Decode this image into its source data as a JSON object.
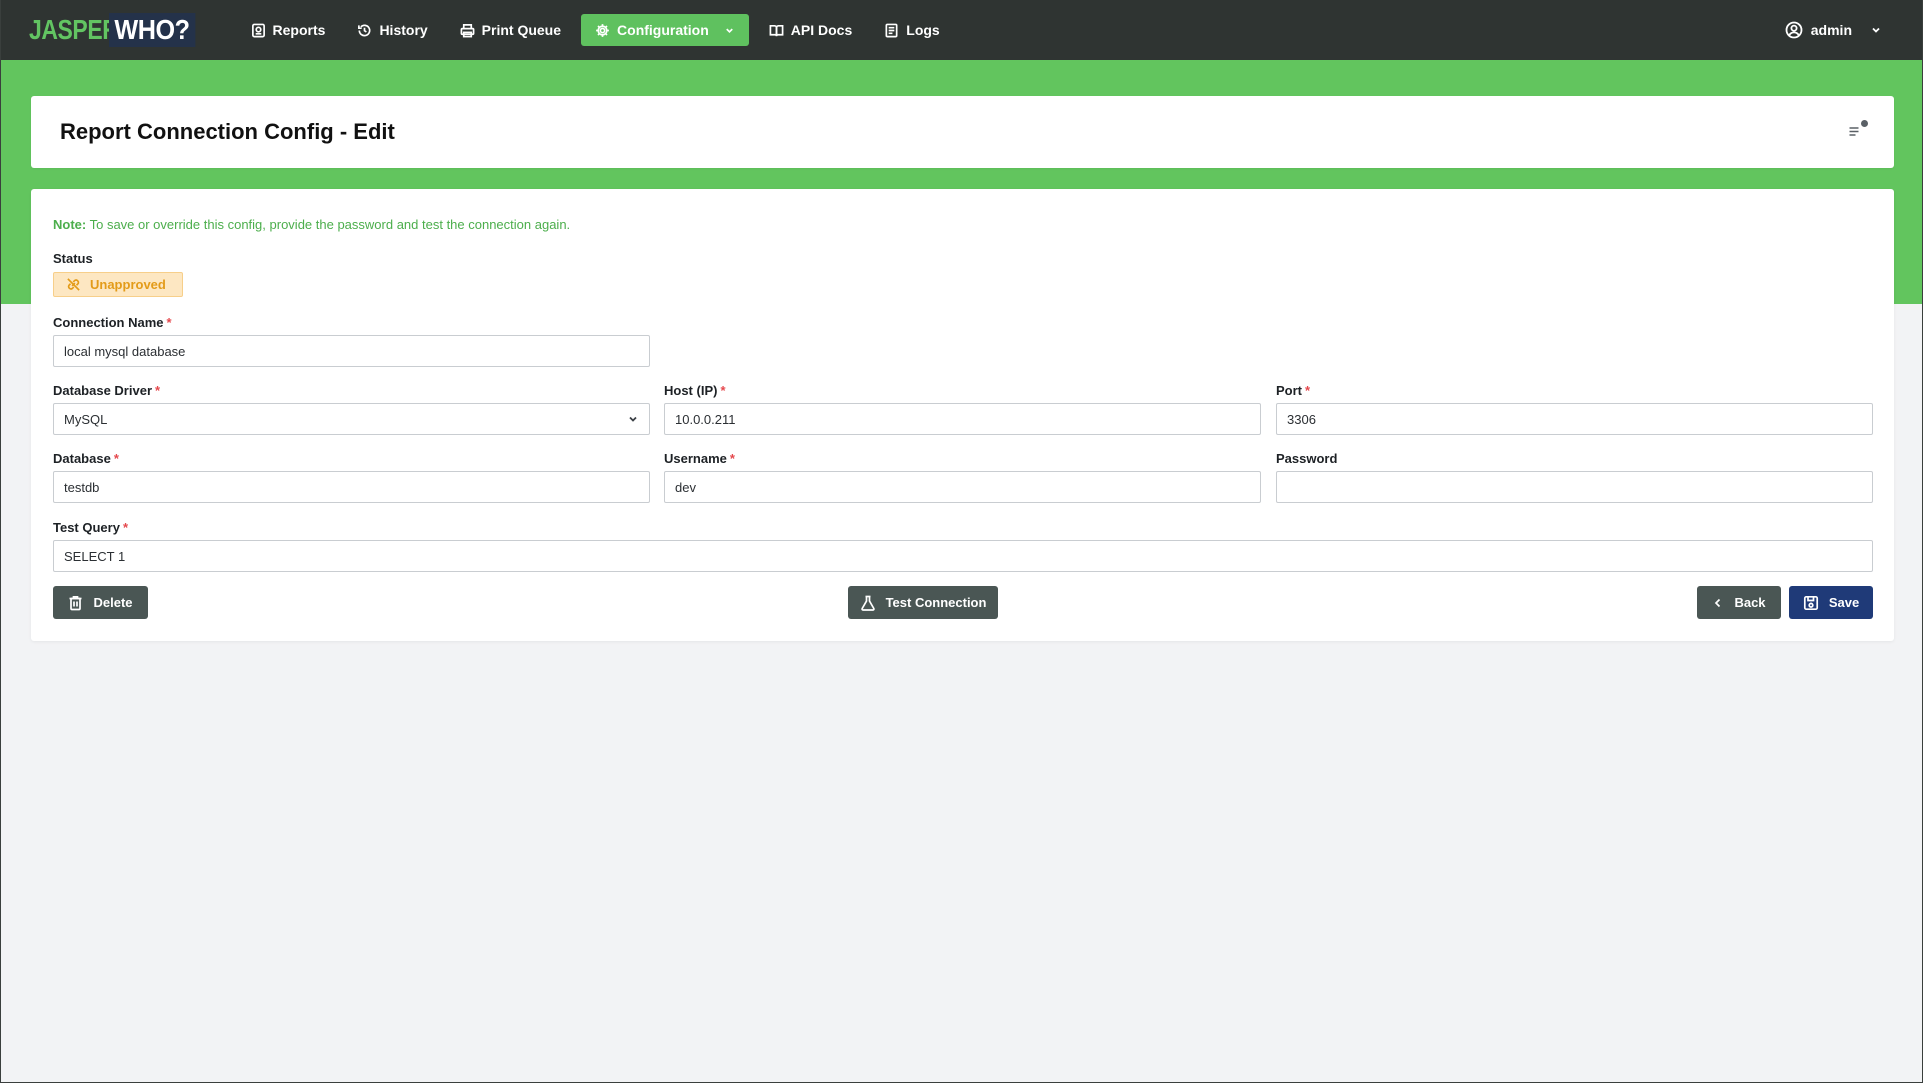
{
  "app": {
    "logo_part1": "JASPER",
    "logo_part2": "WHO?"
  },
  "nav": {
    "items": [
      {
        "label": "Reports",
        "icon": "report-icon"
      },
      {
        "label": "History",
        "icon": "history-icon"
      },
      {
        "label": "Print Queue",
        "icon": "printer-icon"
      },
      {
        "label": "Configuration",
        "icon": "gear-icon",
        "active": true
      },
      {
        "label": "API Docs",
        "icon": "book-icon"
      },
      {
        "label": "Logs",
        "icon": "log-icon"
      }
    ],
    "user": "admin"
  },
  "header": {
    "title": "Report Connection Config - Edit"
  },
  "form": {
    "note_prefix": "Note:",
    "note_text": " To save or override this config, provide the password and test the connection again.",
    "status_label": "Status",
    "status_value": "Unapproved",
    "connection_name_label": "Connection Name",
    "connection_name_value": "local mysql database",
    "driver_label": "Database Driver",
    "driver_value": "MySQL",
    "host_label": "Host (IP)",
    "host_value": "10.0.0.211",
    "port_label": "Port",
    "port_value": "3306",
    "database_label": "Database",
    "database_value": "testdb",
    "username_label": "Username",
    "username_value": "dev",
    "password_label": "Password",
    "password_value": "",
    "query_label": "Test Query",
    "query_value": "SELECT 1",
    "required_mark": "*"
  },
  "actions": {
    "delete": "Delete",
    "test": "Test Connection",
    "back": "Back",
    "save": "Save"
  },
  "colors": {
    "nav_bg": "#2f3432",
    "accent_green": "#62c55e",
    "status_warning": "#e39b19",
    "save_button": "#1f3a78",
    "dark_button": "#4a5654"
  }
}
